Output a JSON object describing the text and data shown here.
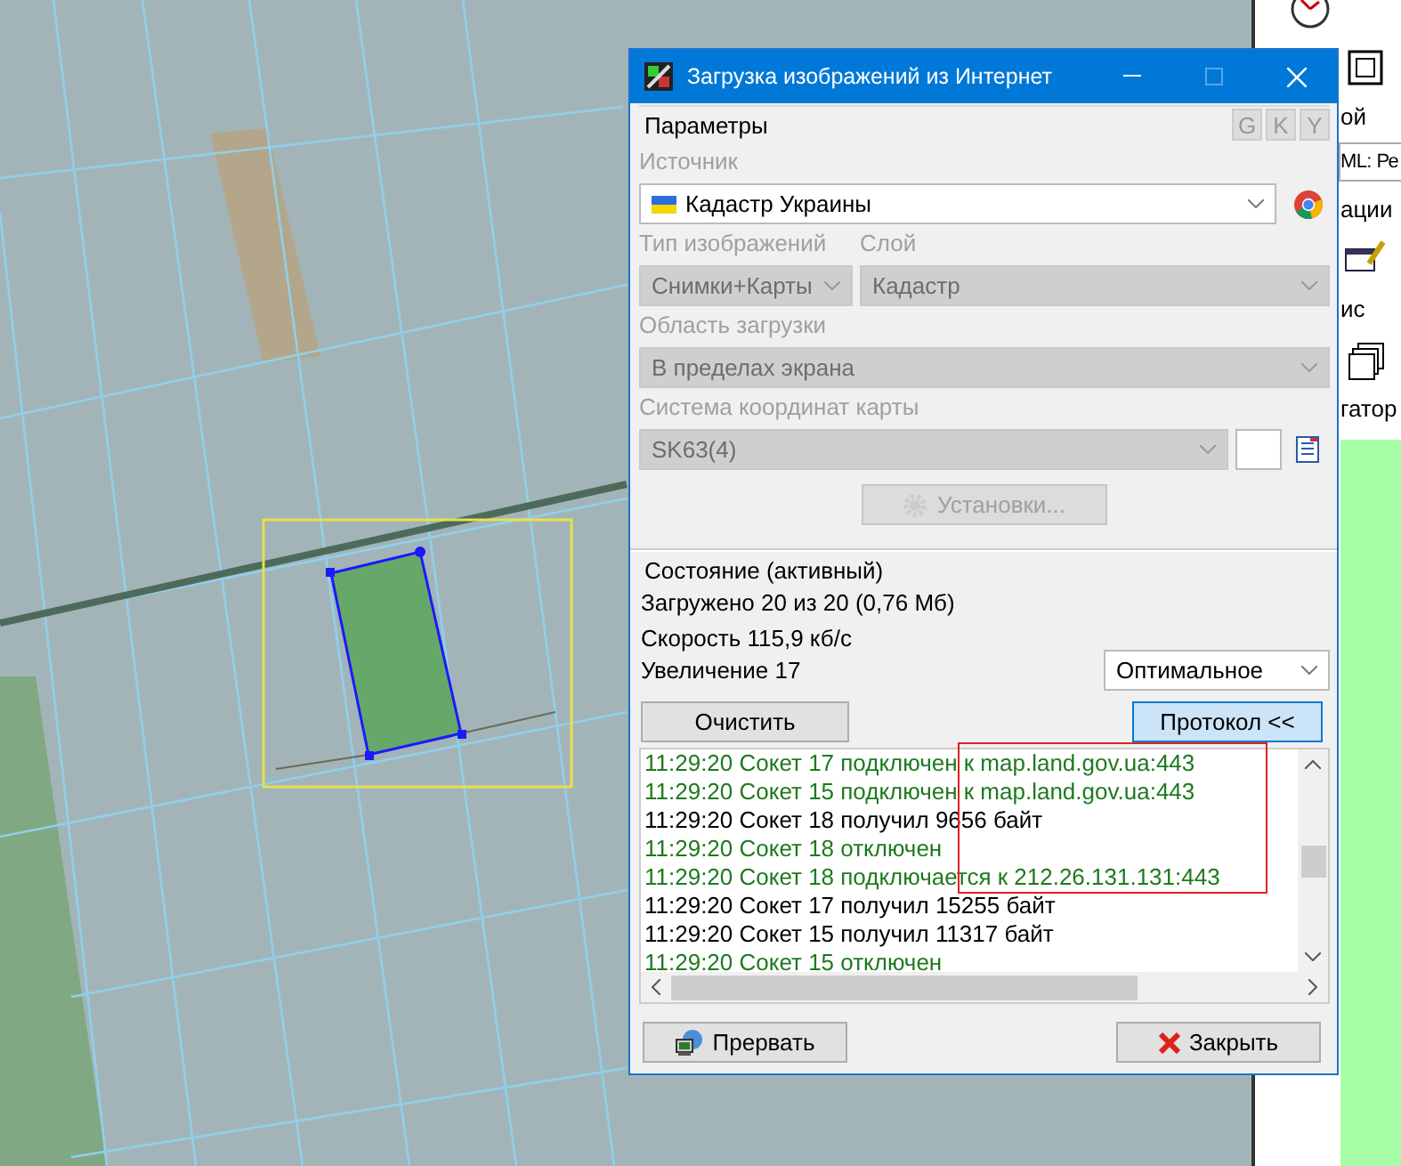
{
  "window": {
    "title": "Загрузка изображений из Интернет"
  },
  "params": {
    "legend": "Параметры",
    "provider_buttons": [
      {
        "label": "G",
        "disabled": true
      },
      {
        "label": "K",
        "disabled": true
      },
      {
        "label": "Y",
        "disabled": true
      }
    ],
    "source": {
      "label": "Источник",
      "value": "Кадастр Украины",
      "disabled": false
    },
    "image_type": {
      "label": "Тип изображений",
      "value": "Снимки+Карты",
      "disabled": true
    },
    "layer": {
      "label": "Слой",
      "value": "Кадастр",
      "disabled": true
    },
    "area": {
      "label": "Область загрузки",
      "value": "В пределах экрана",
      "disabled": true
    },
    "crs": {
      "label": "Система координат карты",
      "value": "SK63(4)",
      "disabled": true
    },
    "settings_button": {
      "label": "Установки...",
      "disabled": true
    }
  },
  "status": {
    "legend": "Состояние (активный)",
    "lines": [
      "Загружено 20 из 20 (0,76 Мб)",
      "Скорость 115,9 кб/с"
    ],
    "zoom_label": "Увеличение 17",
    "zoom_mode": "Оптимальное"
  },
  "clear_button": "Очистить",
  "protocol_button": {
    "label": "Протокол <<",
    "selected": true
  },
  "log": [
    {
      "kind": "event",
      "text": "11:29:20 Сокет 17 подключен к map.land.gov.ua:443"
    },
    {
      "kind": "event",
      "text": "11:29:20 Сокет 15 подключен к map.land.gov.ua:443"
    },
    {
      "kind": "data",
      "text": "11:29:20 Сокет 18 получил 9656 байт"
    },
    {
      "kind": "event",
      "text": "11:29:20 Сокет 18 отключен"
    },
    {
      "kind": "event",
      "text": "11:29:20 Сокет 18 подключается к 212.26.131.131:443"
    },
    {
      "kind": "data",
      "text": "11:29:20 Сокет 17 получил 15255 байт"
    },
    {
      "kind": "data",
      "text": "11:29:20 Сокет 15 получил 11317 байт"
    },
    {
      "kind": "event",
      "text": "11:29:20 Сокет 15 отключен"
    }
  ],
  "footer": {
    "abort_button": "Прервать",
    "close_button": "Закрыть"
  },
  "right_panel": [
    {
      "kind": "group",
      "text": "ой"
    },
    {
      "kind": "field",
      "text": "ML: Ре"
    },
    {
      "kind": "group",
      "text": "ации"
    },
    {
      "kind": "group",
      "text": "ис"
    },
    {
      "kind": "label",
      "text": "гатор"
    }
  ]
}
